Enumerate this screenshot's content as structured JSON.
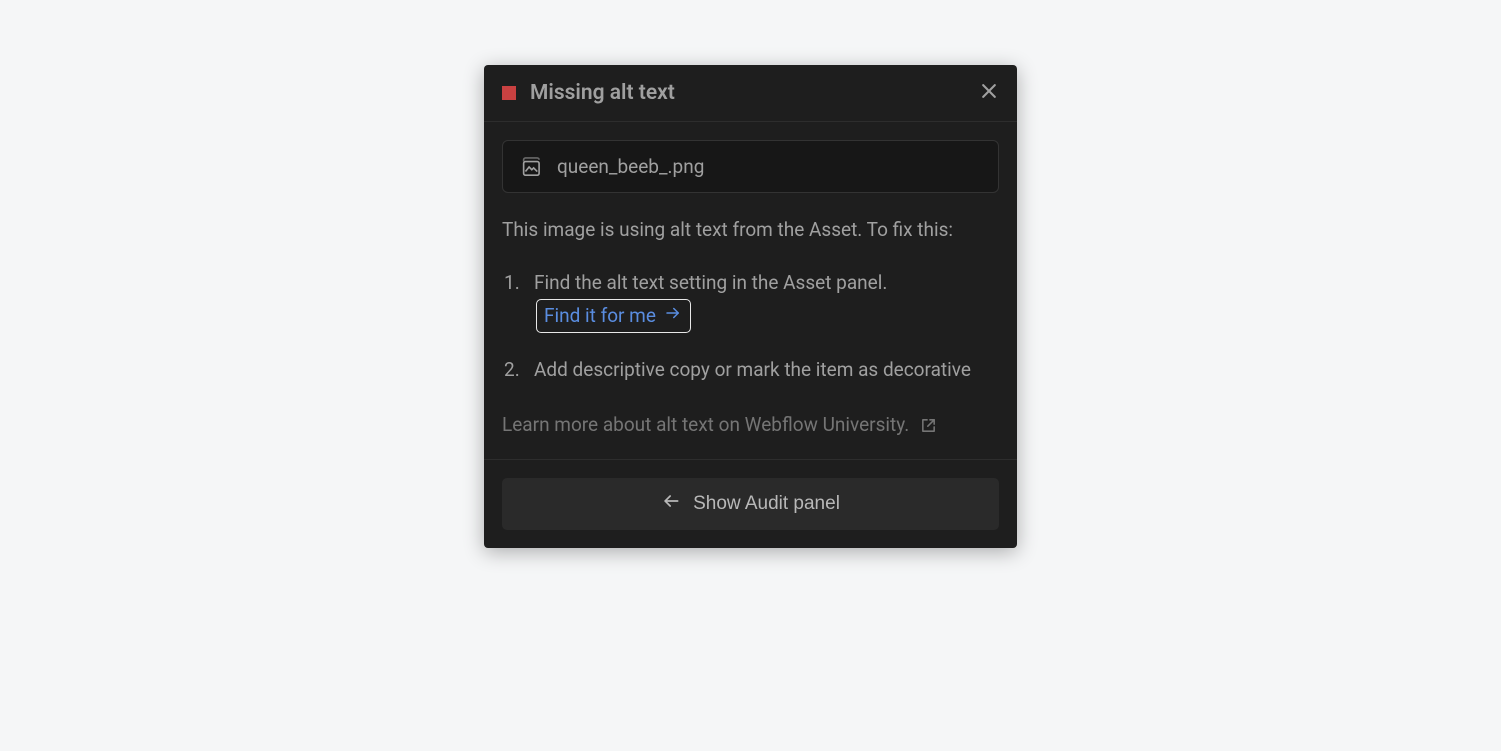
{
  "header": {
    "title": "Missing alt text",
    "severity_color": "#c94141"
  },
  "asset": {
    "filename": "queen_beeb_.png"
  },
  "description": "This image is using alt text from the Asset. To fix this:",
  "steps": {
    "step1_prefix": "Find the alt text setting in the Asset panel.",
    "step1_link": "Find it for me",
    "step2": "Add descriptive copy or mark the item as decorative"
  },
  "learn_more": "Learn more about alt text on Webflow University.",
  "footer": {
    "back_label": "Show Audit panel"
  }
}
